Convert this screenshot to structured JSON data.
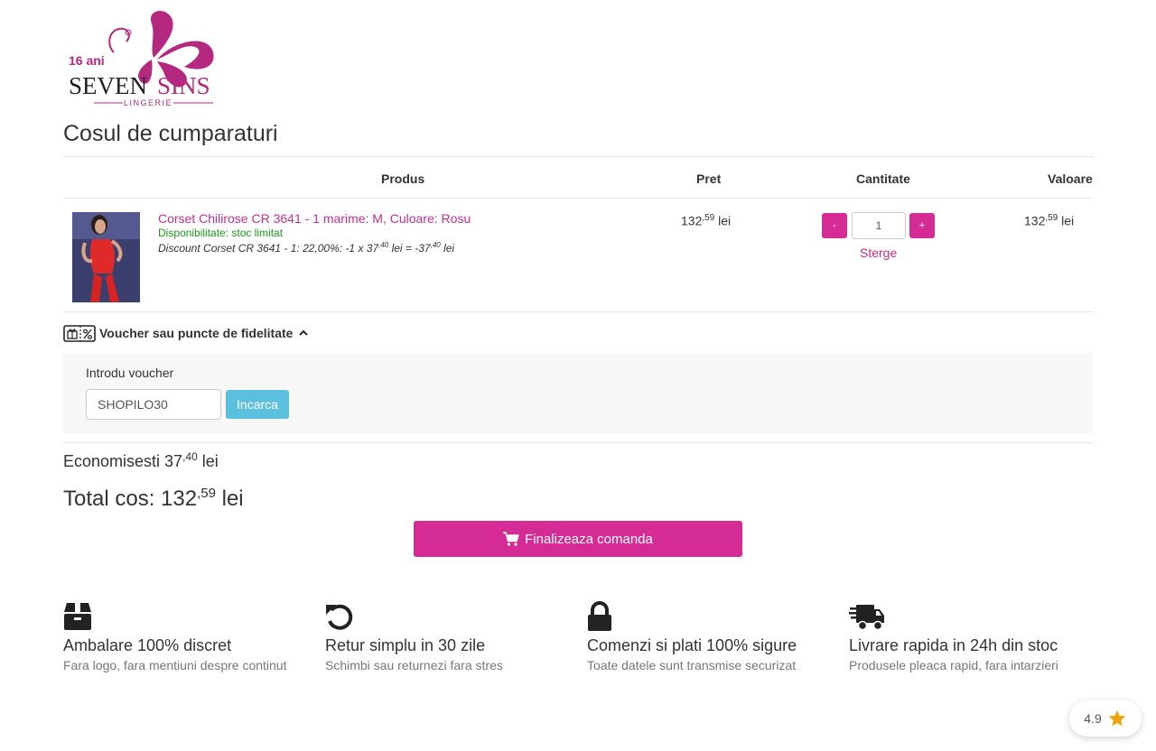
{
  "brand": {
    "anniversary": "16 ani",
    "name_part1": "SEVEN",
    "name_part2": "SINS",
    "tagline": "LINGERIE",
    "accent": "#d42c94"
  },
  "page": {
    "title": "Cosul de cumparaturi"
  },
  "table": {
    "headers": {
      "product": "Produs",
      "price": "Pret",
      "quantity": "Cantitate",
      "value": "Valoare"
    },
    "items": [
      {
        "name": "Corset Chilirose CR 3641 - 1 marime: M, Culoare: Rosu",
        "availability": "Disponibilitate: stoc limitat",
        "discount": {
          "prefix": "Discount Corset CR 3641 - 1: 22,00%: -1 x 37",
          "unit_price_cents": ",40",
          "middle": " lei = -37",
          "total_cents": ",40",
          "suffix": " lei"
        },
        "price": {
          "int": "132",
          "cents": ",59",
          "currency": " lei"
        },
        "quantity": "1",
        "minus_label": "-",
        "plus_label": "+",
        "remove_label": "Sterge",
        "value": {
          "int": "132",
          "cents": ",59",
          "currency": " lei"
        }
      }
    ]
  },
  "voucher": {
    "toggle_label": "Voucher sau puncte de fidelitate",
    "field_label": "Introdu voucher",
    "value": "SHOPILO30",
    "button_label": "Incarca"
  },
  "summary": {
    "savings_label": "Economisesti 37",
    "savings_cents": ",40",
    "savings_currency": " lei",
    "total_label": "Total cos: 132",
    "total_cents": ",59",
    "total_currency": " lei"
  },
  "checkout": {
    "label": "Finalizeaza comanda"
  },
  "features": [
    {
      "icon": "box-icon",
      "title": "Ambalare 100% discret",
      "desc": "Fara logo, fara mentiuni despre continut"
    },
    {
      "icon": "return-icon",
      "title": "Retur simplu in 30 zile",
      "desc": "Schimbi sau returnezi fara stres"
    },
    {
      "icon": "lock-icon",
      "title": "Comenzi si plati 100% sigure",
      "desc": "Toate datele sunt transmise securizat"
    },
    {
      "icon": "truck-icon",
      "title": "Livrare rapida in 24h din stoc",
      "desc": "Produsele pleaca rapid, fara intarzieri"
    }
  ],
  "rating": {
    "value": "4.9",
    "star_color": "#f0a30a"
  }
}
